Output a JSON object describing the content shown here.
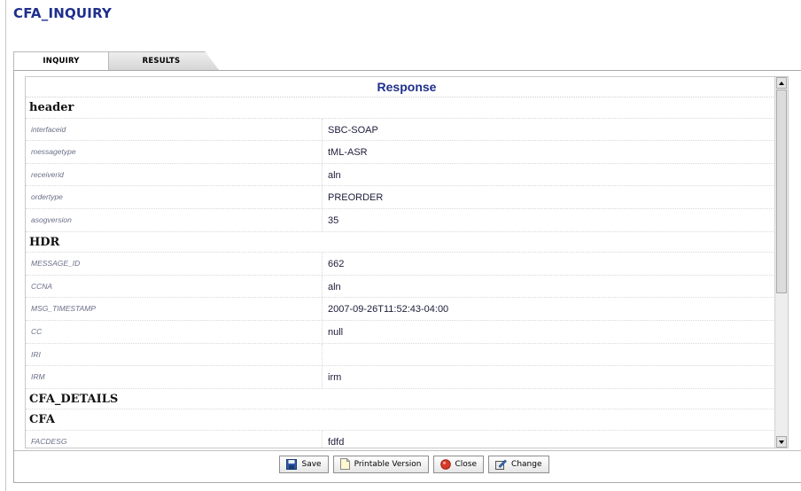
{
  "app": {
    "title": "CFA_INQUIRY"
  },
  "tabs": [
    {
      "label": "INQUIRY"
    },
    {
      "label": "RESULTS"
    }
  ],
  "response": {
    "title": "Response",
    "sections": [
      {
        "label": "header"
      },
      {
        "label": "HDR"
      },
      {
        "label": "CFA_DETAILS"
      },
      {
        "label": "CFA"
      }
    ],
    "header_fields": [
      {
        "key": "interfaceid",
        "value": "SBC-SOAP"
      },
      {
        "key": "messagetype",
        "value": "tML-ASR"
      },
      {
        "key": "receiverid",
        "value": "aln"
      },
      {
        "key": "ordertype",
        "value": "PREORDER"
      },
      {
        "key": "asogversion",
        "value": "35"
      }
    ],
    "hdr_fields": [
      {
        "key": "MESSAGE_ID",
        "value": "662"
      },
      {
        "key": "CCNA",
        "value": "aln"
      },
      {
        "key": "MSG_TIMESTAMP",
        "value": "2007-09-26T11:52:43-04:00"
      },
      {
        "key": "CC",
        "value": "null"
      },
      {
        "key": "IRI",
        "value": ""
      },
      {
        "key": "IRM",
        "value": "irm"
      }
    ],
    "cfa_fields": [
      {
        "key": "FACDESG",
        "value": "fdfd"
      }
    ]
  },
  "footer": {
    "buttons": [
      {
        "label": "Save",
        "icon": "floppy-disk-icon"
      },
      {
        "label": "Printable Version",
        "icon": "document-icon"
      },
      {
        "label": "Close",
        "icon": "red-circle-icon"
      },
      {
        "label": "Change",
        "icon": "edit-icon"
      }
    ]
  },
  "colors": {
    "title": "#1f2f8c",
    "key_text": "#6b6f88"
  }
}
